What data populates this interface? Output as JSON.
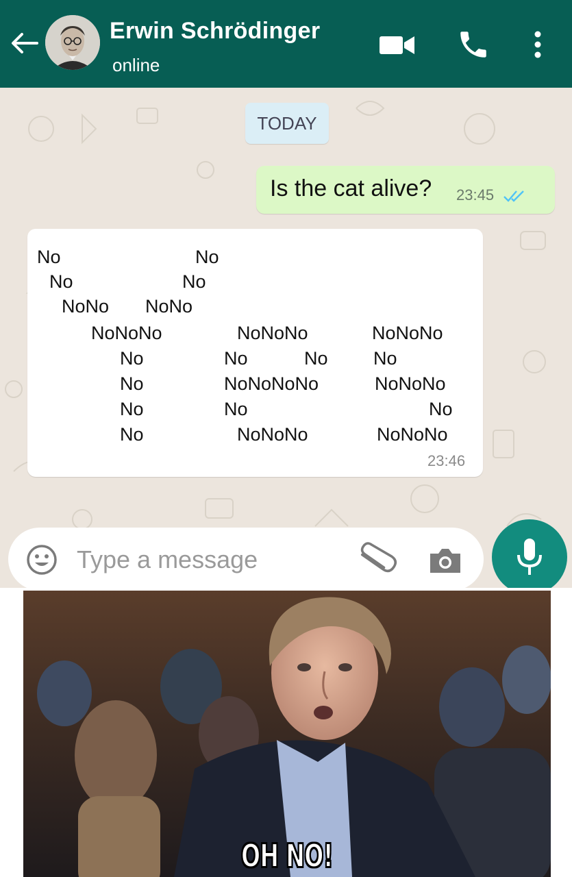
{
  "header": {
    "contact_name": "Erwin Schrödinger",
    "status": "online",
    "color": "#075e54",
    "icons": [
      "back-arrow-icon",
      "video-call-icon",
      "phone-icon",
      "more-vert-icon"
    ]
  },
  "chat": {
    "date_label": "TODAY",
    "background": "#ece5dd",
    "outgoing": {
      "text": "Is the cat alive?",
      "time": "23:45",
      "status": "read",
      "color": "#dcf8c6"
    },
    "incoming": {
      "lines": [
        "No",
        "No",
        "No",
        "No",
        "NoNo",
        "NoNo",
        "NoNoNo",
        "No",
        "No",
        "No",
        "No",
        "NoNoNo",
        "No",
        "No",
        "NoNoNoNo",
        "No",
        "NoNoNo",
        "NoNoNo",
        "No",
        "NoNoNo",
        "No",
        "NoNoNo"
      ],
      "time": "23:46"
    }
  },
  "input": {
    "placeholder": "Type a message",
    "icons": [
      "emoji-icon",
      "attach-icon",
      "camera-icon",
      "mic-icon"
    ],
    "accent": "#128c7e"
  },
  "meme": {
    "caption": "OH NO!"
  }
}
